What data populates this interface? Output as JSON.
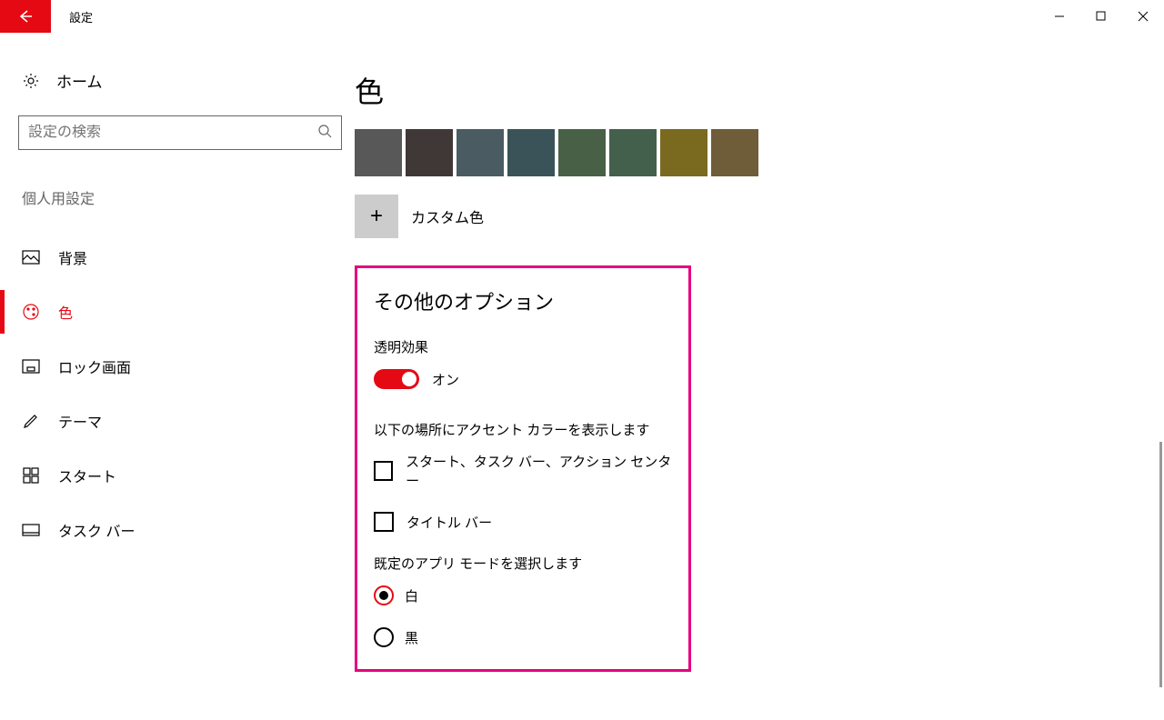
{
  "window": {
    "title": "設定"
  },
  "sidebar": {
    "home": "ホーム",
    "search_placeholder": "設定の検索",
    "section": "個人用設定",
    "items": [
      {
        "label": "背景"
      },
      {
        "label": "色"
      },
      {
        "label": "ロック画面"
      },
      {
        "label": "テーマ"
      },
      {
        "label": "スタート"
      },
      {
        "label": "タスク バー"
      }
    ]
  },
  "main": {
    "title": "色",
    "swatches": [
      "#585858",
      "#403836",
      "#4a5c62",
      "#3a5358",
      "#486046",
      "#43604d",
      "#7a6a1f",
      "#6f5d3a"
    ],
    "custom_label": "カスタム色",
    "other_title": "その他のオプション",
    "transparency_label": "透明効果",
    "toggle_state": "オン",
    "accent_label": "以下の場所にアクセント カラーを表示します",
    "check1": "スタート、タスク バー、アクション センター",
    "check2": "タイトル バー",
    "mode_label": "既定のアプリ モードを選択します",
    "radio1": "白",
    "radio2": "黒"
  }
}
